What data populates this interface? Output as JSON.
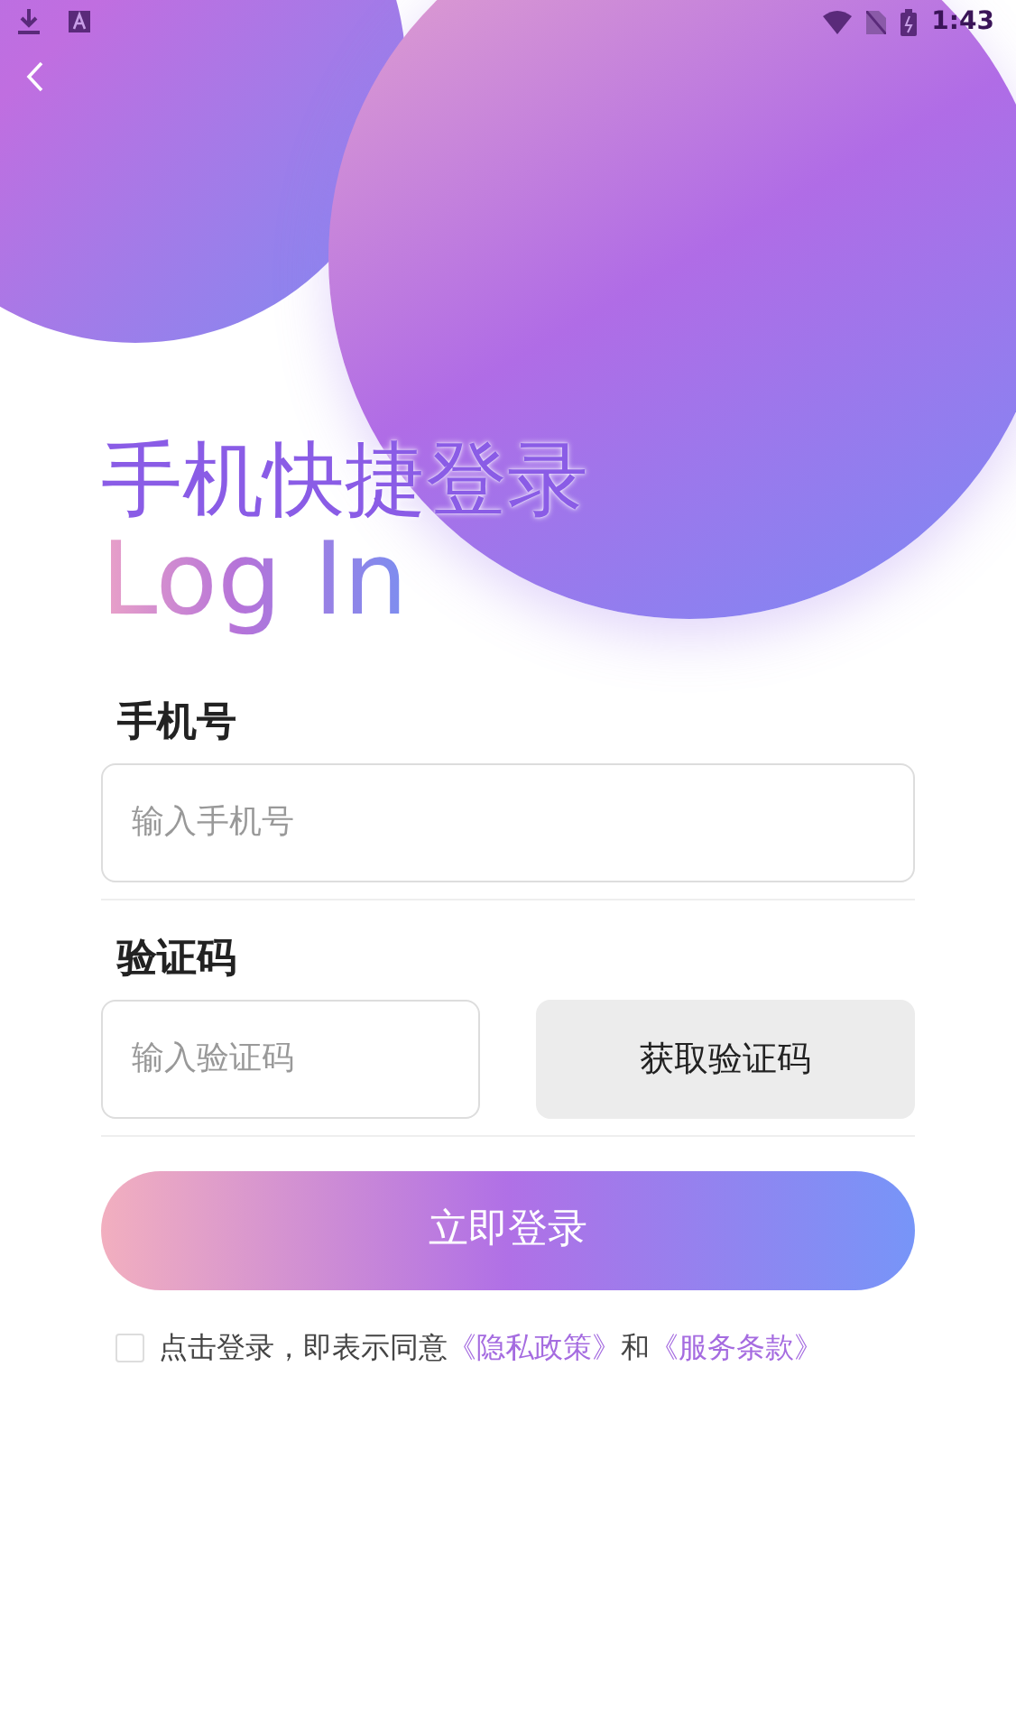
{
  "status_bar": {
    "time": "1:43"
  },
  "title": "手机快捷登录",
  "subtitle": "Log In",
  "phone": {
    "label": "手机号",
    "placeholder": "输入手机号"
  },
  "code": {
    "label": "验证码",
    "placeholder": "输入验证码",
    "button": "获取验证码"
  },
  "login_button": "立即登录",
  "agreement": {
    "checked": false,
    "parts": [
      {
        "kind": "text",
        "text": "点击登录，即表示同意"
      },
      {
        "kind": "link",
        "text": "《隐私政策》"
      },
      {
        "kind": "text",
        "text": "和"
      },
      {
        "kind": "link",
        "text": "《服务条款》"
      }
    ]
  }
}
